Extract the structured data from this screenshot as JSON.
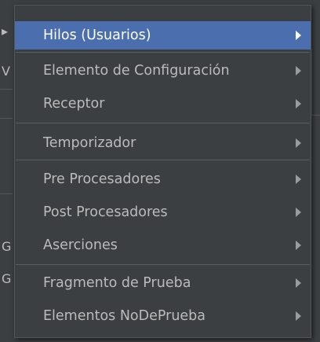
{
  "background": {
    "fragments": [
      "",
      "V",
      "G",
      "G"
    ]
  },
  "menu": {
    "items": [
      {
        "label": "Hilos (Usuarios)",
        "selected": true
      },
      {
        "label": "Elemento de Configuración"
      },
      {
        "label": "Receptor"
      },
      {
        "label": "Temporizador"
      },
      {
        "label": "Pre Procesadores"
      },
      {
        "label": "Post Procesadores"
      },
      {
        "label": "Aserciones"
      },
      {
        "label": "Fragmento de Prueba"
      },
      {
        "label": "Elementos NoDePrueba"
      }
    ]
  },
  "colors": {
    "menu_background": "#3c3f41",
    "selection": "#4b6eaf",
    "text": "#bbbbbb",
    "selected_text": "#ffffff",
    "separator": "#5a5e61"
  }
}
